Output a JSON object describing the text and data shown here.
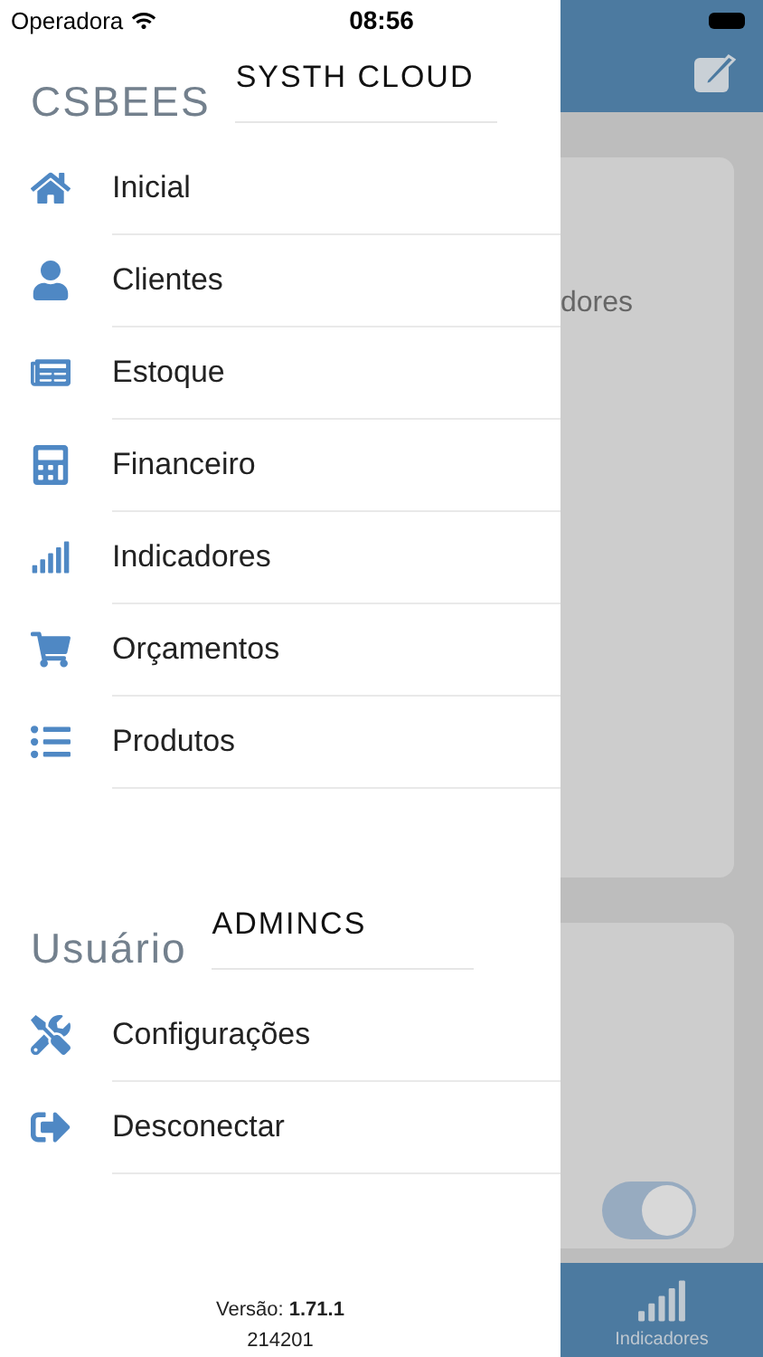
{
  "status_bar": {
    "carrier": "Operadora",
    "time": "08:56"
  },
  "drawer": {
    "brand": "CSBEES",
    "account": "SYSTH CLOUD",
    "menu": [
      {
        "label": "Inicial"
      },
      {
        "label": "Clientes"
      },
      {
        "label": "Estoque"
      },
      {
        "label": "Financeiro"
      },
      {
        "label": "Indicadores"
      },
      {
        "label": "Orçamentos"
      },
      {
        "label": "Produtos"
      }
    ],
    "user_section": {
      "label": "Usuário",
      "username": "ADMINCS"
    },
    "user_menu": [
      {
        "label": "Configurações"
      },
      {
        "label": "Desconectar"
      }
    ],
    "version": "Versão: **1.71.1**",
    "build": "214201"
  },
  "background": {
    "card_text": "dores",
    "toggle": {
      "on": true
    },
    "tab_bar": {
      "label": "Indicadores"
    }
  }
}
